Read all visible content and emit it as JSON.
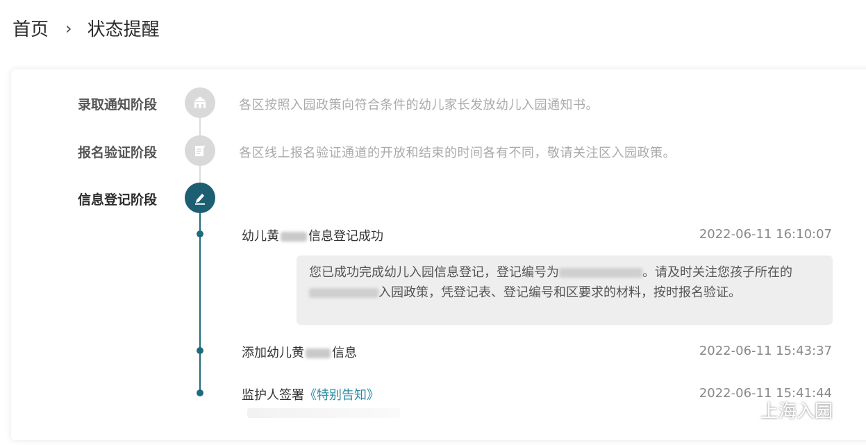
{
  "breadcrumb": {
    "home": "首页",
    "separator": "›",
    "current": "状态提醒"
  },
  "stages": [
    {
      "label": "录取通知阶段",
      "icon": "building-icon",
      "description": "各区按照入园政策向符合条件的幼儿家长发放幼儿入园通知书。",
      "active": false
    },
    {
      "label": "报名验证阶段",
      "icon": "document-icon",
      "description": "各区线上报名验证通道的开放和结束的时间各有不同，敬请关注区入园政策。",
      "active": false
    },
    {
      "label": "信息登记阶段",
      "icon": "pen-icon",
      "description": "",
      "active": true
    }
  ],
  "events": [
    {
      "title_prefix": "幼儿黄",
      "title_suffix": "信息登记成功",
      "time": "2022-06-11 16:10:07"
    },
    {
      "title_prefix": "添加幼儿黄",
      "title_suffix": "信息",
      "time": "2022-06-11 15:43:37"
    },
    {
      "title_prefix": "监护人签署",
      "link": "《特别告知》",
      "time": "2022-06-11 15:41:44"
    }
  ],
  "message": {
    "part1": "您已成功完成幼儿入园信息登记，登记编号为",
    "part2": "。请及时关注您孩子所在的",
    "part3": "入园政策，凭登记表、登记编号和区要求的材料，按时报名验证。"
  },
  "watermark": {
    "text": "上海入园",
    "icon": "wechat-icon"
  },
  "colors": {
    "accent": "#1d6b7d",
    "link": "#2a8aa0",
    "inactive_icon": "#d9d9d9"
  }
}
